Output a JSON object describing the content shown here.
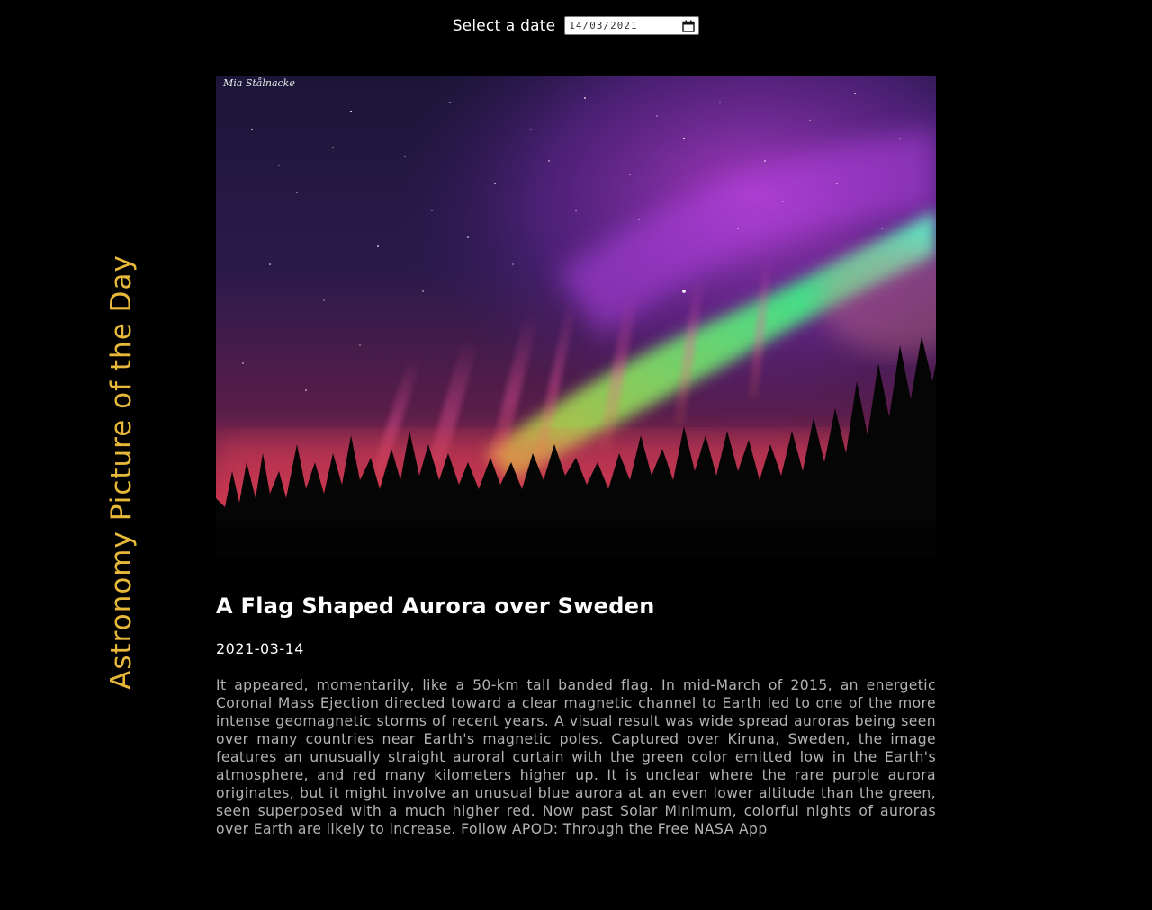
{
  "date_picker": {
    "label": "Select a date",
    "value": "14/03/2021",
    "icon": "calendar-icon"
  },
  "side_title": "Astronomy Picture of the Day",
  "image": {
    "credit": "Mia Stålnacke"
  },
  "apod": {
    "title": "A Flag Shaped Aurora over Sweden",
    "date": "2021-03-14",
    "explanation": "It appeared, momentarily, like a 50-km tall banded flag. In mid-March of 2015, an energetic Coronal Mass Ejection directed toward a clear magnetic channel to Earth led to one of the more intense geomagnetic storms of recent years. A visual result was wide spread auroras being seen over many countries near Earth's magnetic poles. Captured over Kiruna, Sweden, the image features an unusually straight auroral curtain with the green color emitted low in the Earth's atmosphere, and red many kilometers higher up. It is unclear where the rare purple aurora originates, but it might involve an unusual blue aurora at an even lower altitude than the green, seen superposed with a much higher red. Now past Solar Minimum, colorful nights of auroras over Earth are likely to increase. Follow APOD: Through the Free NASA App"
  },
  "colors": {
    "background": "#000000",
    "accent": "#e8b938",
    "text": "#ffffff",
    "body_text": "#b3b3b3"
  }
}
